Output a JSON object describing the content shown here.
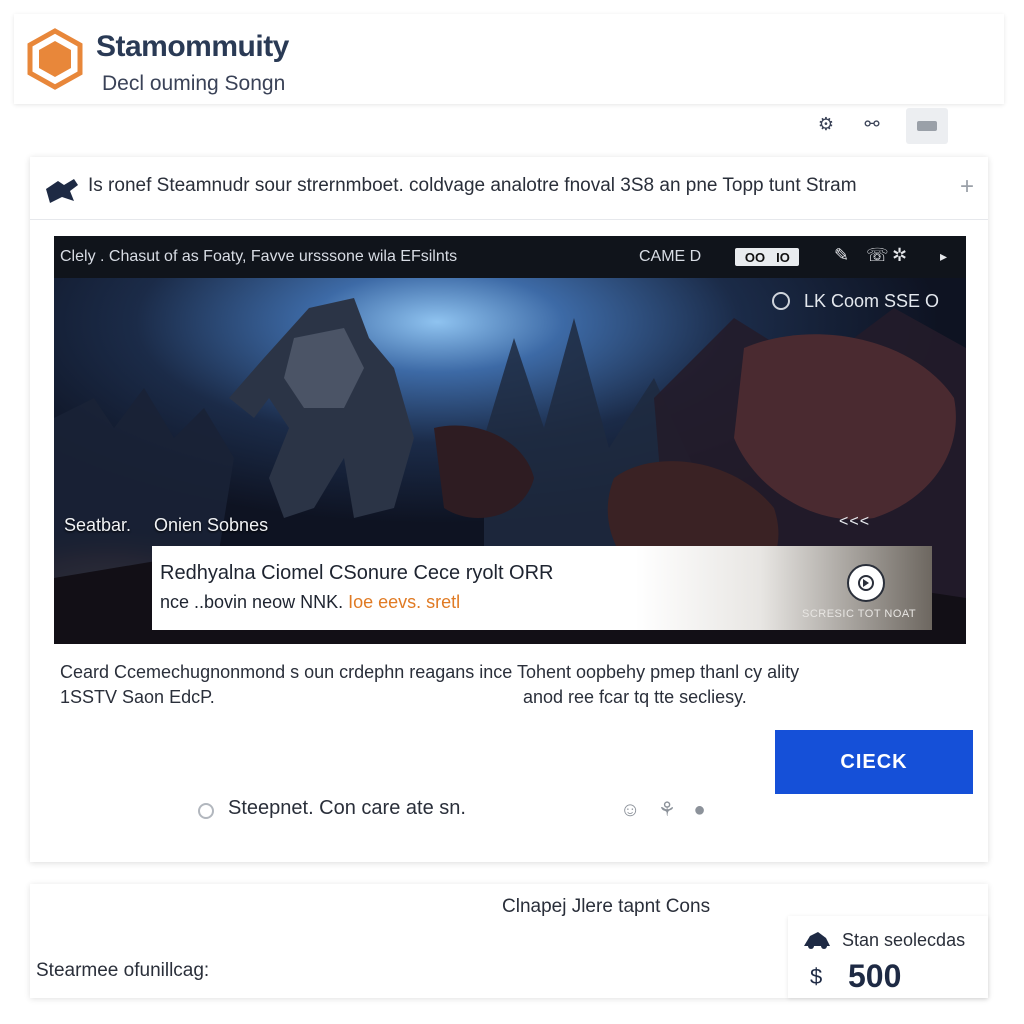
{
  "header": {
    "brand_title": "Stamommuity",
    "brand_subtitle": "Decl ouming Songn",
    "icons": [
      "settings-gear-icon",
      "link-icon",
      "window-icon"
    ]
  },
  "card": {
    "header_text": "Is ronef Steamnudr sour strernmboet. coldvage analotre fnoval 3S8 an pne Topp tunt Stram",
    "header_plus": "+",
    "game": {
      "topbar_title": "Clely . Chasut of as Foaty, Favve ursssone wila EFsilnts",
      "mode_label": "CAME D",
      "box1": "OO",
      "box2": "IO",
      "topbar_icons": [
        "mic-icon",
        "chat-icon",
        "settings-icon",
        "play-icon"
      ],
      "coord_text": "LK Coom SSE O",
      "scene_label_left": "Seatbar.",
      "scene_label_right": "Onien Sobnes",
      "scene_arrows": "<<<",
      "notice_line1": "Redhyalna Ciomel CSonure Cece ryolt ORR",
      "notice_line2_prefix": "nce ..bovin neow NNK.",
      "notice_line2_highlight": "Ioe eevs. sretl",
      "notice_caption": "SCRESIC TOT NOAT"
    },
    "description_line1": "Ceard Ccemechugnonmond s oun crdephn reagans ince Tohent oopbehy pmep thanl cy ality",
    "description_line2a": "1SSTV Saon EdcP.",
    "description_line2b": "anod ree fcar tq tte secliesy.",
    "check_button": "CIECK",
    "status_text": "Steepnet. Con care ate sn.",
    "action_icons": "☺ ⚘ ●"
  },
  "bottom": {
    "center_text": "Clnapej Jlere tapnt Cons",
    "left_text": "Stearmee ofunillcag:",
    "stat_label": "Stan seolecdas",
    "stat_currency": "$",
    "stat_value": "500"
  },
  "colors": {
    "accent_blue": "#1550d8",
    "logo_orange": "#e8873a",
    "highlight_orange": "#e07a23"
  }
}
